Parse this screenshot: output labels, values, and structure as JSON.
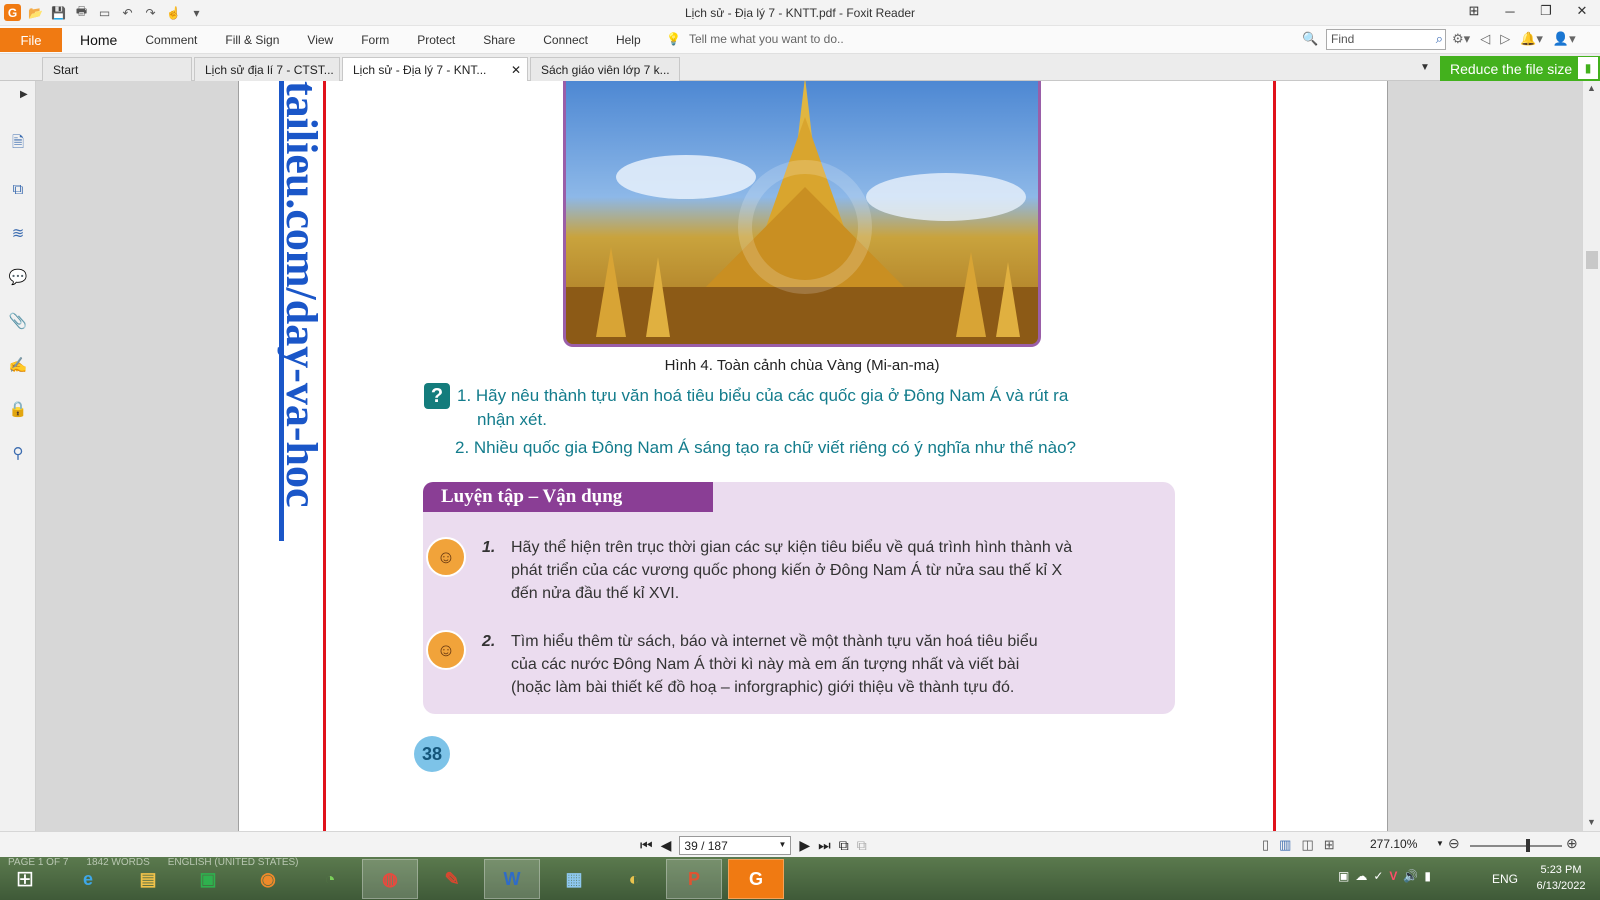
{
  "window": {
    "title": "Lịch sử - Địa lý 7 - KNTT.pdf - Foxit Reader"
  },
  "ribbon": {
    "file_label": "File",
    "menu": [
      "Home",
      "Comment",
      "Fill & Sign",
      "View",
      "Form",
      "Protect",
      "Share",
      "Connect",
      "Help"
    ],
    "tell_me_placeholder": "Tell me what you want to do..",
    "find_placeholder": "Find"
  },
  "tabs": [
    {
      "label": "Start"
    },
    {
      "label": "Lịch sử địa lí 7 - CTST..."
    },
    {
      "label": "Lịch sử - Địa lý 7 - KNT..."
    },
    {
      "label": "Sách giáo viên lớp 7 k..."
    }
  ],
  "reduce_button": "Reduce the file size",
  "document": {
    "watermark": "tailieu.com/day-va-hoc",
    "caption": "Hình 4. Toàn cảnh chùa Vàng (Mi-an-ma)",
    "questions": [
      "1. Hãy nêu thành tựu văn hoá tiêu biểu của các quốc gia ở Đông Nam Á và rút ra",
      "nhận xét.",
      "2. Nhiều quốc gia Đông Nam Á sáng tạo ra chữ viết riêng có ý nghĩa như thế nào?"
    ],
    "practice_title": "Luyện tập – Vận dụng",
    "practice_items": [
      {
        "num": "1.",
        "lines": [
          "Hãy thể hiện trên trục thời gian các sự kiện tiêu biểu về quá trình hình thành và",
          "phát triển của các vương quốc phong kiến ở Đông Nam Á từ nửa sau thế kỉ X",
          "đến nửa đầu thế kỉ XVI."
        ]
      },
      {
        "num": "2.",
        "lines": [
          "Tìm hiểu thêm từ sách, báo và internet về một thành tựu văn hoá tiêu biểu",
          "của các nước Đông Nam Á thời kì này mà em ấn tượng nhất và viết bài",
          "(hoặc làm bài thiết kế đồ hoạ – inforgraphic) giới thiệu về thành tựu đó."
        ]
      }
    ],
    "page_number": "38"
  },
  "statusbar": {
    "page_field": "39 / 187",
    "zoom": "277.10%",
    "ghost": [
      "PAGE 1 OF 7",
      "1842 WORDS",
      "ENGLISH (UNITED STATES)"
    ]
  },
  "taskbar": {
    "apps": [
      "IE",
      "Explorer",
      "Store",
      "Firefox",
      "Coc Coc",
      "Chrome",
      "Paint",
      "Word",
      "Photos",
      "Paint 3D",
      "PowerPoint",
      "Foxit PDF"
    ],
    "lang": "ENG",
    "time": "5:23 PM",
    "date": "6/13/2022"
  }
}
